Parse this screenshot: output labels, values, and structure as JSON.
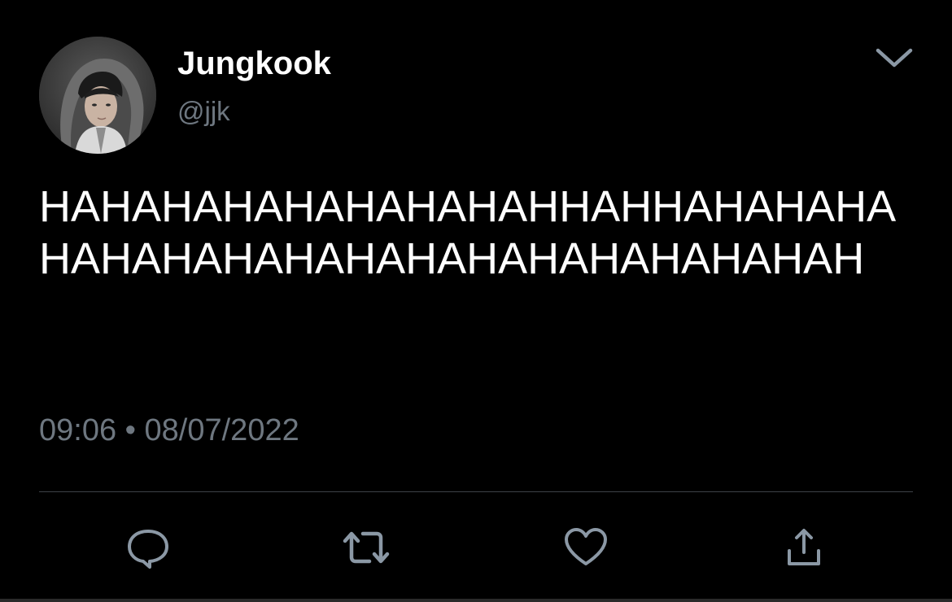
{
  "tweet": {
    "author": {
      "display_name": "Jungkook",
      "handle": "@jjk"
    },
    "text": "HAHAHAHAHAHAHAHAHHAHHAHAHAHAHAHAHAHAHAHAHAHAHAHAHAHAHAH",
    "time": "09:06",
    "separator": "•",
    "date": "08/07/2022"
  },
  "icons": {
    "more": "chevron-down-icon",
    "reply": "reply-icon",
    "retweet": "retweet-icon",
    "like": "heart-icon",
    "share": "share-icon"
  },
  "colors": {
    "background": "#000000",
    "primary_text": "#ffffff",
    "secondary_text": "#6e7780",
    "divider": "#3d4247",
    "icon": "#8b98a5"
  }
}
